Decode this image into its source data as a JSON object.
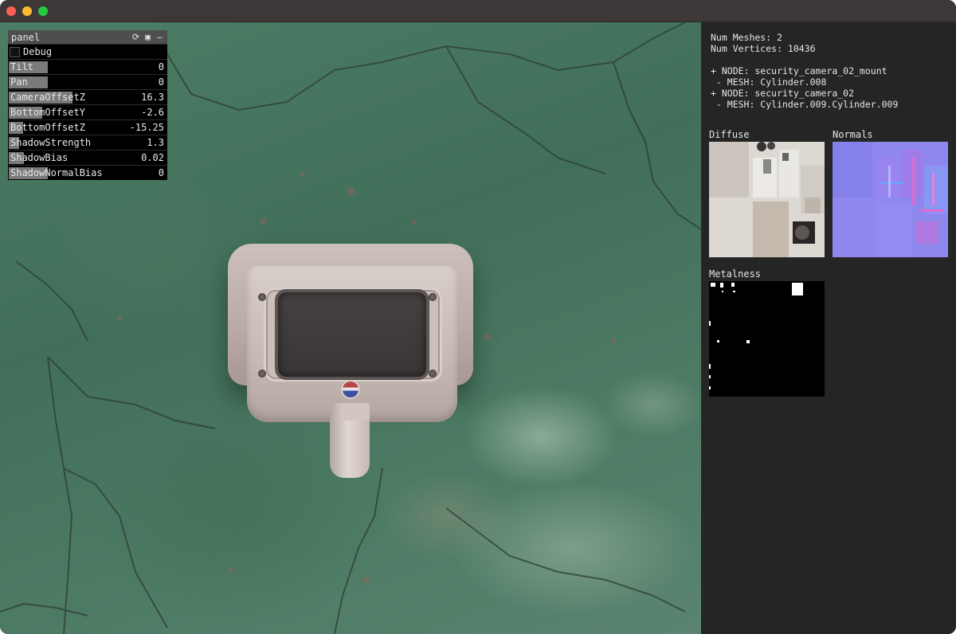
{
  "window": {
    "controls": [
      "close",
      "minimize",
      "maximize"
    ]
  },
  "gui": {
    "title": "panel",
    "header_icons": [
      "refresh-icon",
      "save-icon",
      "minimize-icon"
    ],
    "header_glyphs": {
      "refresh": "⟳",
      "save": "▣",
      "minimize": "–"
    },
    "debug_label": "Debug",
    "debug_checked": false,
    "sliders": [
      {
        "label": "Tilt",
        "value": "0",
        "fill": 0.5
      },
      {
        "label": "Pan",
        "value": "0",
        "fill": 0.5
      },
      {
        "label": "CameraOffsetZ",
        "value": "16.3",
        "fill": 0.82
      },
      {
        "label": "BottomOffsetY",
        "value": "-2.6",
        "fill": 0.43
      },
      {
        "label": "BottomOffsetZ",
        "value": "-15.25",
        "fill": 0.18
      },
      {
        "label": "ShadowStrength",
        "value": "1.3",
        "fill": 0.13
      },
      {
        "label": "ShadowBias",
        "value": "0.02",
        "fill": 0.19
      },
      {
        "label": "ShadowNormalBias",
        "value": "0",
        "fill": 0.5
      }
    ]
  },
  "info": {
    "num_meshes": "Num Meshes: 2",
    "num_vertices": "Num Vertices: 10436",
    "nodes": [
      "+ NODE: security_camera_02_mount",
      " - MESH: Cylinder.008",
      "+ NODE: security_camera_02",
      " - MESH: Cylinder.009.Cylinder.009"
    ],
    "textures": {
      "diffuse": "Diffuse",
      "normals": "Normals",
      "metalness": "Metalness"
    }
  },
  "colors": {
    "slider_fill": "#7a7a7a",
    "panel_bg": "#000000",
    "info_bg": "#252525",
    "titlebar": "#3d3837"
  }
}
